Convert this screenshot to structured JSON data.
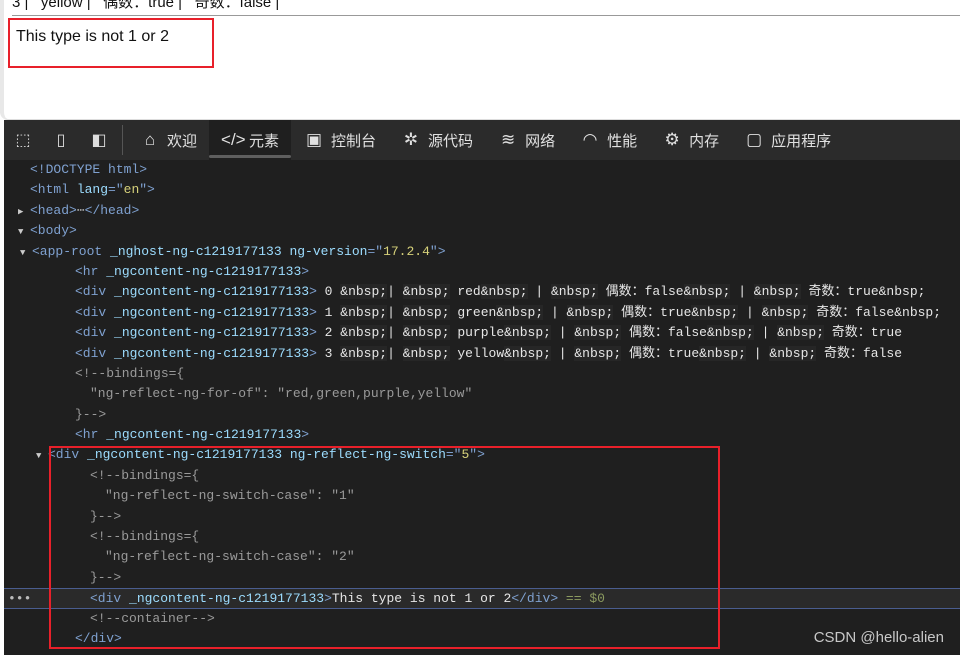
{
  "page": {
    "top_partial_line": "3 |   yellow |   偶数：true |   奇数：false |",
    "result_text": "This type is not 1 or 2"
  },
  "toolbar": {
    "left_icons": [
      "inspect-icon",
      "device-emulation-icon",
      "dock-side-icon"
    ],
    "tabs": [
      {
        "label": "欢迎",
        "icon": "home-icon",
        "glyph": "⌂"
      },
      {
        "label": "元素",
        "icon": "code-icon",
        "glyph": "</>",
        "active": true
      },
      {
        "label": "控制台",
        "icon": "console-icon",
        "glyph": "▣"
      },
      {
        "label": "源代码",
        "icon": "bug-icon",
        "glyph": "✲"
      },
      {
        "label": "网络",
        "icon": "wifi-icon",
        "glyph": "≋"
      },
      {
        "label": "性能",
        "icon": "gauge-icon",
        "glyph": "◠"
      },
      {
        "label": "内存",
        "icon": "chip-icon",
        "glyph": "⚙"
      },
      {
        "label": "应用程序",
        "icon": "window-icon",
        "glyph": "▢"
      }
    ]
  },
  "tree": {
    "lines": [
      {
        "depth": 0,
        "parts": [
          [
            "tag",
            "<!DOCTYPE html>"
          ]
        ]
      },
      {
        "depth": 0,
        "parts": [
          [
            "tag",
            "<html "
          ],
          [
            "an",
            "lang"
          ],
          [
            "tag",
            "=\""
          ],
          [
            "av",
            "en"
          ],
          [
            "tag",
            "\">"
          ]
        ]
      },
      {
        "depth": 0,
        "arrow": "▶",
        "parts": [
          [
            "tag",
            "<head>"
          ],
          [
            "cm",
            "⋯"
          ],
          [
            "tag",
            "</head>"
          ]
        ]
      },
      {
        "depth": 0,
        "arrow": "▼",
        "parts": [
          [
            "tag",
            "<body>"
          ]
        ]
      },
      {
        "depth": 1,
        "arrow": "▼",
        "parts": [
          [
            "tag",
            "<app-root "
          ],
          [
            "an",
            "_nghost-ng-c1219177133 ng-version"
          ],
          [
            "tag",
            "=\""
          ],
          [
            "av",
            "17.2.4"
          ],
          [
            "tag",
            "\">"
          ]
        ]
      },
      {
        "depth": 3,
        "parts": [
          [
            "tag",
            "<hr "
          ],
          [
            "an",
            "_ngcontent-ng-c1219177133"
          ],
          [
            "tag",
            ">"
          ]
        ]
      },
      {
        "depth": 3,
        "parts": [
          [
            "tag",
            "<div "
          ],
          [
            "an",
            "_ngcontent-ng-c1219177133"
          ],
          [
            "tag",
            "> "
          ],
          [
            "tx",
            "0 "
          ],
          [
            "ent",
            "&nbsp;"
          ],
          [
            "tx",
            "| "
          ],
          [
            "ent",
            "&nbsp;"
          ],
          [
            "tx",
            " red"
          ],
          [
            "ent",
            "&nbsp;"
          ],
          [
            "tx",
            " | "
          ],
          [
            "ent",
            "&nbsp;"
          ],
          [
            "tx",
            " 偶数：false"
          ],
          [
            "ent",
            "&nbsp;"
          ],
          [
            "tx",
            " | "
          ],
          [
            "ent",
            "&nbsp;"
          ],
          [
            "tx",
            " 奇数：true&nbsp;"
          ]
        ]
      },
      {
        "depth": 3,
        "parts": [
          [
            "tag",
            "<div "
          ],
          [
            "an",
            "_ngcontent-ng-c1219177133"
          ],
          [
            "tag",
            "> "
          ],
          [
            "tx",
            "1 "
          ],
          [
            "ent",
            "&nbsp;"
          ],
          [
            "tx",
            "| "
          ],
          [
            "ent",
            "&nbsp;"
          ],
          [
            "tx",
            " green"
          ],
          [
            "ent",
            "&nbsp;"
          ],
          [
            "tx",
            " | "
          ],
          [
            "ent",
            "&nbsp;"
          ],
          [
            "tx",
            " 偶数：true"
          ],
          [
            "ent",
            "&nbsp;"
          ],
          [
            "tx",
            " | "
          ],
          [
            "ent",
            "&nbsp;"
          ],
          [
            "tx",
            " 奇数：false&nbsp;"
          ]
        ]
      },
      {
        "depth": 3,
        "parts": [
          [
            "tag",
            "<div "
          ],
          [
            "an",
            "_ngcontent-ng-c1219177133"
          ],
          [
            "tag",
            "> "
          ],
          [
            "tx",
            "2 "
          ],
          [
            "ent",
            "&nbsp;"
          ],
          [
            "tx",
            "| "
          ],
          [
            "ent",
            "&nbsp;"
          ],
          [
            "tx",
            " purple"
          ],
          [
            "ent",
            "&nbsp;"
          ],
          [
            "tx",
            " | "
          ],
          [
            "ent",
            "&nbsp;"
          ],
          [
            "tx",
            " 偶数：false"
          ],
          [
            "ent",
            "&nbsp;"
          ],
          [
            "tx",
            " | "
          ],
          [
            "ent",
            "&nbsp;"
          ],
          [
            "tx",
            " 奇数：true"
          ]
        ]
      },
      {
        "depth": 3,
        "parts": [
          [
            "tag",
            "<div "
          ],
          [
            "an",
            "_ngcontent-ng-c1219177133"
          ],
          [
            "tag",
            "> "
          ],
          [
            "tx",
            "3 "
          ],
          [
            "ent",
            "&nbsp;"
          ],
          [
            "tx",
            "| "
          ],
          [
            "ent",
            "&nbsp;"
          ],
          [
            "tx",
            " yellow"
          ],
          [
            "ent",
            "&nbsp;"
          ],
          [
            "tx",
            " | "
          ],
          [
            "ent",
            "&nbsp;"
          ],
          [
            "tx",
            " 偶数：true"
          ],
          [
            "ent",
            "&nbsp;"
          ],
          [
            "tx",
            " | "
          ],
          [
            "ent",
            "&nbsp;"
          ],
          [
            "tx",
            " 奇数：false"
          ]
        ]
      },
      {
        "depth": 3,
        "parts": [
          [
            "cm",
            "<!--bindings={"
          ]
        ]
      },
      {
        "depth": 4,
        "parts": [
          [
            "cm",
            "\"ng-reflect-ng-for-of\": \"red,green,purple,yellow\""
          ]
        ]
      },
      {
        "depth": 3,
        "parts": [
          [
            "cm",
            "}-->"
          ]
        ]
      },
      {
        "depth": 3,
        "parts": [
          [
            "tag",
            "<hr "
          ],
          [
            "an",
            "_ngcontent-ng-c1219177133"
          ],
          [
            "tag",
            ">"
          ]
        ]
      },
      {
        "depth": 2,
        "arrow": "▼",
        "parts": [
          [
            "tag",
            "<div "
          ],
          [
            "an",
            "_ngcontent-ng-c1219177133 ng-reflect-ng-switch"
          ],
          [
            "tag",
            "=\""
          ],
          [
            "av",
            "5"
          ],
          [
            "tag",
            "\">"
          ]
        ]
      },
      {
        "depth": 4,
        "parts": [
          [
            "cm",
            "<!--bindings={"
          ]
        ]
      },
      {
        "depth": 5,
        "parts": [
          [
            "cm",
            "\"ng-reflect-ng-switch-case\": \"1\""
          ]
        ]
      },
      {
        "depth": 4,
        "parts": [
          [
            "cm",
            "}-->"
          ]
        ]
      },
      {
        "depth": 4,
        "parts": [
          [
            "cm",
            "<!--bindings={"
          ]
        ]
      },
      {
        "depth": 5,
        "parts": [
          [
            "cm",
            "\"ng-reflect-ng-switch-case\": \"2\""
          ]
        ]
      },
      {
        "depth": 4,
        "parts": [
          [
            "cm",
            "}-->"
          ]
        ]
      },
      {
        "depth": 4,
        "selected": true,
        "parts": [
          [
            "tag",
            "<div "
          ],
          [
            "an",
            "_ngcontent-ng-c1219177133"
          ],
          [
            "tag",
            ">"
          ],
          [
            "tx",
            "This type is not 1 or 2"
          ],
          [
            "tag",
            "</div>"
          ],
          [
            "eq",
            " == $0"
          ]
        ]
      },
      {
        "depth": 4,
        "parts": [
          [
            "cm",
            "<!--container-->"
          ]
        ]
      },
      {
        "depth": 3,
        "parts": [
          [
            "tag",
            "</div>"
          ]
        ]
      }
    ]
  },
  "watermark": "CSDN @hello-alien"
}
